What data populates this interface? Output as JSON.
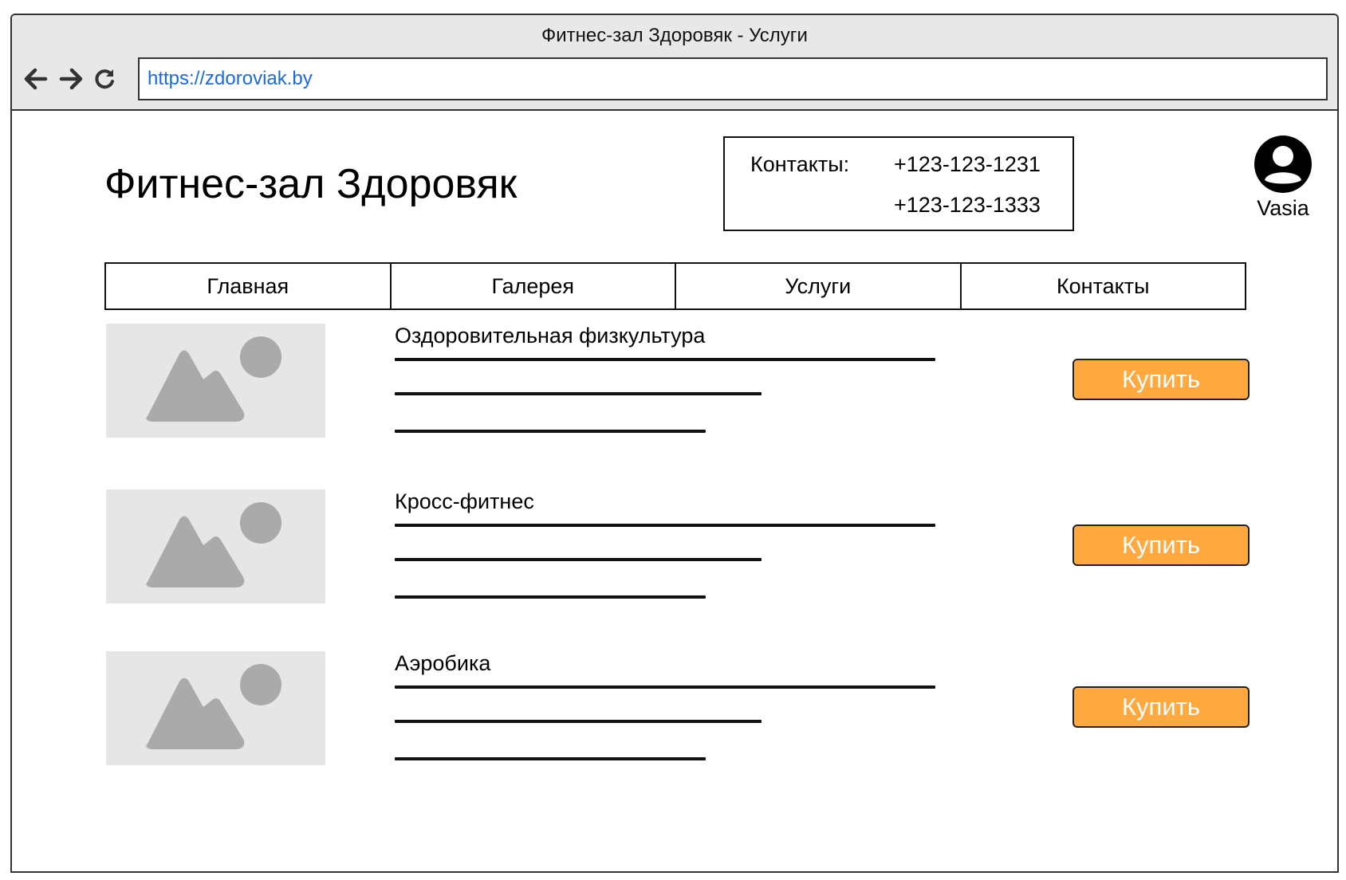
{
  "window": {
    "title": "Фитнес-зал Здоровяк - Услуги",
    "url": "https://zdoroviak.by"
  },
  "header": {
    "site_title": "Фитнес-зал Здоровяк",
    "contacts_label": "Контакты:",
    "phones": [
      "+123-123-1231",
      "+123-123-1333"
    ],
    "user_name": "Vasia"
  },
  "menu": {
    "items": [
      {
        "label": "Главная"
      },
      {
        "label": "Галерея"
      },
      {
        "label": "Услуги"
      },
      {
        "label": "Контакты"
      }
    ]
  },
  "services": [
    {
      "name": "Оздоровительная физкультура",
      "button": "Купить"
    },
    {
      "name": "Кросс-фитнес",
      "button": "Купить"
    },
    {
      "name": "Аэробика",
      "button": "Купить"
    }
  ],
  "colors": {
    "accent": "#ffa940",
    "link": "#1d6ad9",
    "placeholder_bg": "#e6e6e6",
    "placeholder_fg": "#aaaaaa"
  },
  "icons": {
    "back": "arrow-left-icon",
    "forward": "arrow-right-icon",
    "reload": "reload-icon",
    "user": "user-avatar-icon",
    "image": "image-placeholder-icon"
  }
}
